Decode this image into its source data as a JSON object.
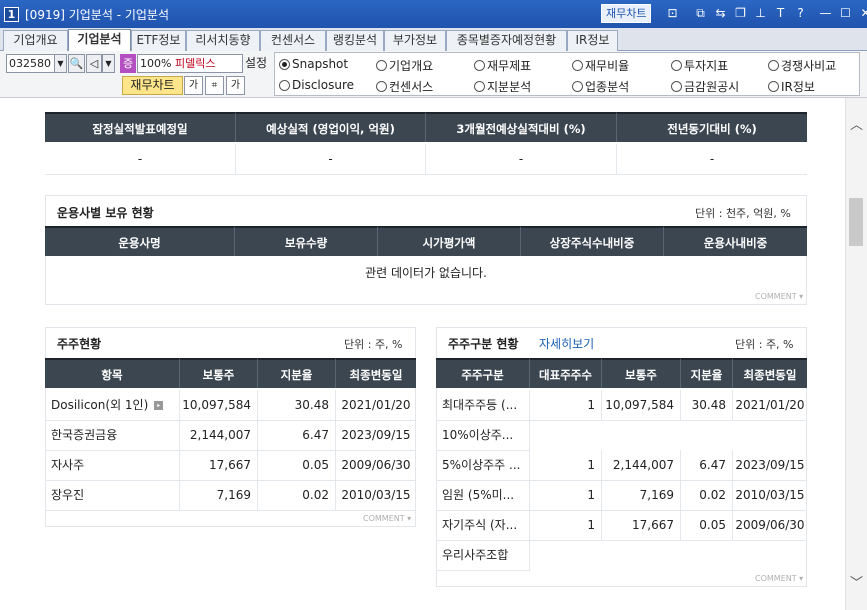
{
  "window": {
    "number": "1",
    "title": "[0919] 기업분석 - 기업분석",
    "fin_chart_btn": "재무차트"
  },
  "tabs": [
    "기업개요",
    "기업분석",
    "ETF정보",
    "리서치동향",
    "컨센서스",
    "랭킹분석",
    "부가정보",
    "종목별증자예정현황",
    "IR정보"
  ],
  "active_tab": 1,
  "toolbar": {
    "code": "032580",
    "percent": "100%",
    "jeung": "증",
    "stock_name": "피델릭스",
    "settings": "설정",
    "fin_chart": "재무차트"
  },
  "radios": [
    {
      "label": "Snapshot",
      "checked": true
    },
    {
      "label": "기업개요",
      "checked": false
    },
    {
      "label": "재무제표",
      "checked": false
    },
    {
      "label": "재무비율",
      "checked": false
    },
    {
      "label": "투자지표",
      "checked": false
    },
    {
      "label": "경쟁사비교",
      "checked": false
    },
    {
      "label": "Disclosure",
      "checked": false
    },
    {
      "label": "컨센서스",
      "checked": false
    },
    {
      "label": "지분분석",
      "checked": false
    },
    {
      "label": "업종분석",
      "checked": false
    },
    {
      "label": "금감원공시",
      "checked": false
    },
    {
      "label": "IR정보",
      "checked": false
    }
  ],
  "earnings": {
    "headers": [
      "잠정실적발표예정일",
      "예상실적 (영업이익, 억원)",
      "3개월전예상실적대비 (%)",
      "전년동기대비 (%)"
    ],
    "row": [
      "-",
      "-",
      "-",
      "-"
    ]
  },
  "fund": {
    "title": "운용사별 보유 현황",
    "unit": "단위 : 천주, 억원, %",
    "headers": [
      "운용사명",
      "보유수량",
      "시가평가액",
      "상장주식수내비중",
      "운용사내비중"
    ],
    "nodata": "관련 데이터가 없습니다.",
    "comment": "COMMENT"
  },
  "holders": {
    "title": "주주현황",
    "unit": "단위 : 주, %",
    "headers": [
      "항목",
      "보통주",
      "지분율",
      "최종변동일"
    ],
    "rows": [
      [
        "Dosilicon(외 1인)",
        "10,097,584",
        "30.48",
        "2021/01/20"
      ],
      [
        "한국증권금융",
        "2,144,007",
        "6.47",
        "2023/09/15"
      ],
      [
        "자사주",
        "17,667",
        "0.05",
        "2009/06/30"
      ],
      [
        "장우진",
        "7,169",
        "0.02",
        "2010/03/15"
      ]
    ],
    "comment": "COMMENT"
  },
  "groups": {
    "title": "주주구분 현황",
    "link": "자세히보기",
    "unit": "단위 : 주, %",
    "headers": [
      "주주구분",
      "대표주주수",
      "보통주",
      "지분율",
      "최종변동일"
    ],
    "rows": [
      [
        "최대주주등 (...",
        "1",
        "10,097,584",
        "30.48",
        "2021/01/20"
      ],
      [
        "10%이상주...",
        "",
        "",
        "",
        ""
      ],
      [
        "5%이상주주 ...",
        "1",
        "2,144,007",
        "6.47",
        "2023/09/15"
      ],
      [
        "임원 (5%미...",
        "1",
        "7,169",
        "0.02",
        "2010/03/15"
      ],
      [
        "자기주식 (자...",
        "1",
        "17,667",
        "0.05",
        "2009/06/30"
      ],
      [
        "우리사주조합",
        "",
        "",
        "",
        ""
      ]
    ],
    "comment": "COMMENT"
  }
}
